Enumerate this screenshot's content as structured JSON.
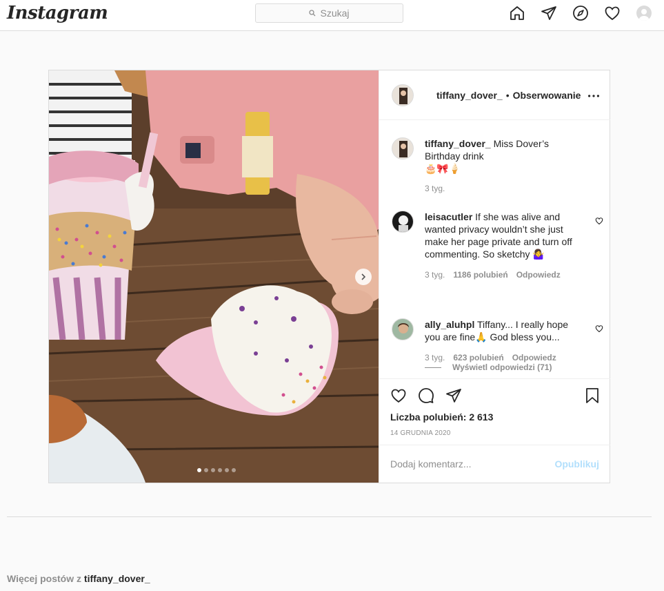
{
  "app": {
    "logo_text": "Instagram"
  },
  "search": {
    "placeholder": "Szukaj"
  },
  "nav_icons": [
    "home-icon",
    "direct-icon",
    "explore-icon",
    "activity-heart-icon",
    "profile-avatar"
  ],
  "post": {
    "username": "tiffany_dover_",
    "separator": "•",
    "follow_label": "Obserwowanie",
    "carousel": {
      "slides": 6,
      "active_index": 0
    },
    "caption": {
      "username": "tiffany_dover_",
      "text": "Miss Dover’s Birthday drink",
      "emoji": "🎂🎀🍦",
      "time": "3 tyg."
    },
    "comments": [
      {
        "username": "leisacutler",
        "text": "If she was alive and wanted privacy wouldn’t she just make her page private and turn off commenting. So sketchy 🤷‍♀️",
        "time": "3 tyg.",
        "likes": "1186 polubień",
        "reply_label": "Odpowiedz"
      },
      {
        "username": "ally_aluhpl",
        "text": "Tiffany... I really hope you are fine🙏 God bless you...",
        "time": "3 tyg.",
        "likes": "623 polubień",
        "reply_label": "Odpowiedz"
      }
    ],
    "view_replies": "Wyświetl odpowiedzi (71)",
    "likes_count": "Liczba polubień: 2 613",
    "date": "14 GRUDNIA 2020",
    "comment_placeholder": "Dodaj komentarz...",
    "publish_label": "Opublikuj"
  },
  "footer": {
    "more_posts_prefix": "Więcej postów z",
    "more_posts_user": "tiffany_dover_"
  },
  "colors": {
    "accent_disabled": "#b2dffc",
    "border": "#dbdbdb",
    "muted": "#8e8e8e"
  }
}
